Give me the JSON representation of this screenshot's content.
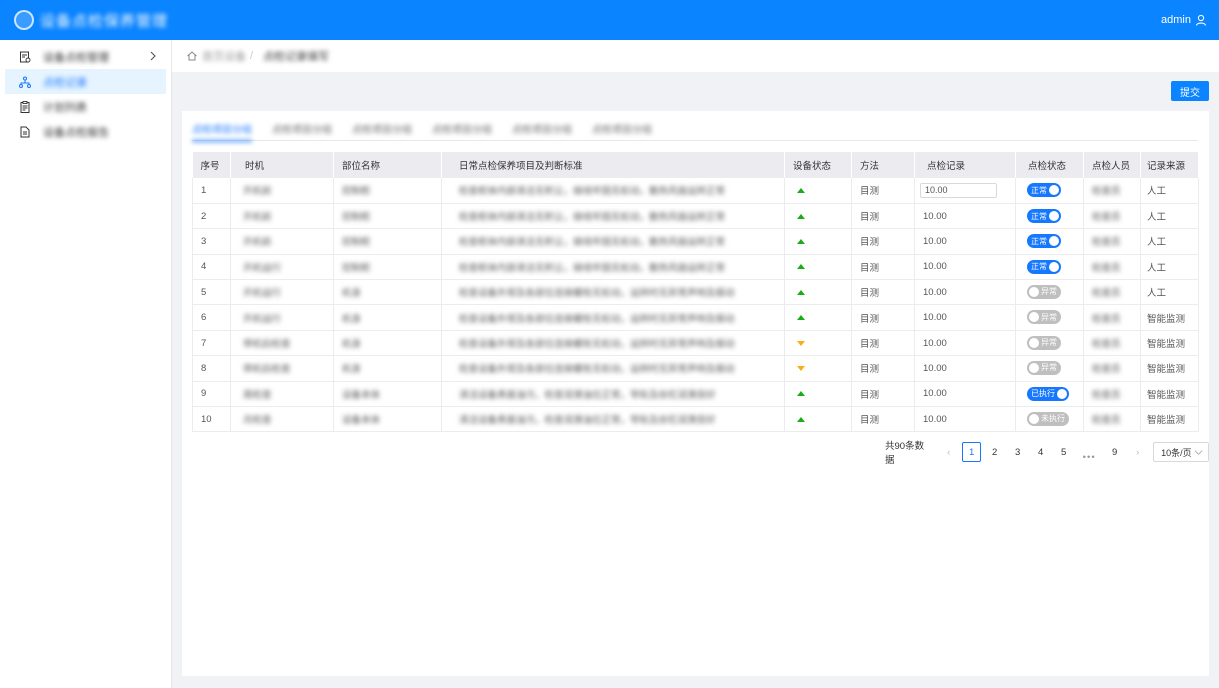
{
  "header": {
    "app_title": "设备点检保养管理",
    "user_name": "admin",
    "user_icon": "user-icon",
    "colors": {
      "primary": "#0a84ff"
    }
  },
  "sidebar": {
    "items": [
      {
        "label": "设备点检管理",
        "icon": "document-check-icon",
        "active": false,
        "has_arrow": true
      },
      {
        "label": "点检记录",
        "icon": "tree-structure-icon",
        "active": true
      },
      {
        "label": "计划列表",
        "icon": "clipboard-icon",
        "active": false
      },
      {
        "label": "设备点检报告",
        "icon": "file-icon",
        "active": false
      }
    ]
  },
  "breadcrumb": {
    "home": "首页设备",
    "current": "点检记录填写"
  },
  "submit_label": "提交",
  "tabs": [
    "点检项目分组",
    "点检项目分组",
    "点检项目分组",
    "点检项目分组",
    "点检项目分组",
    "点检项目分组"
  ],
  "table": {
    "columns": [
      "序号",
      "时机",
      "部位名称",
      "日常点检保养项目及判断标准",
      "设备状态",
      "方法",
      "点检记录",
      "点检状态",
      "点检人员",
      "记录来源"
    ],
    "rows": [
      {
        "no": "1",
        "timing": "开机前",
        "part": "控制柜",
        "standard": "检查柜体内部清洁无积尘，接线牢固无松动，散热风扇运转正常",
        "status": "up",
        "method": "目测",
        "record": "10.00",
        "editable": true,
        "check": "正常",
        "check_on": true,
        "inspector": "检查员",
        "source": "人工"
      },
      {
        "no": "2",
        "timing": "开机前",
        "part": "控制柜",
        "standard": "检查柜体内部清洁无积尘，接线牢固无松动，散热风扇运转正常",
        "status": "up",
        "method": "目测",
        "record": "10.00",
        "editable": false,
        "check": "正常",
        "check_on": true,
        "inspector": "检查员",
        "source": "人工"
      },
      {
        "no": "3",
        "timing": "开机前",
        "part": "控制柜",
        "standard": "检查柜体内部清洁无积尘，接线牢固无松动，散热风扇运转正常",
        "status": "up",
        "method": "目测",
        "record": "10.00",
        "editable": false,
        "check": "正常",
        "check_on": true,
        "inspector": "检查员",
        "source": "人工"
      },
      {
        "no": "4",
        "timing": "开机运行",
        "part": "控制柜",
        "standard": "检查柜体内部清洁无积尘，接线牢固无松动，散热风扇运转正常",
        "status": "up",
        "method": "目测",
        "record": "10.00",
        "editable": false,
        "check": "正常",
        "check_on": true,
        "inspector": "检查员",
        "source": "人工"
      },
      {
        "no": "5",
        "timing": "开机运行",
        "part": "机身",
        "standard": "检查设备外观及各部位连接螺栓无松动，运转时无异常声响及振动",
        "status": "up",
        "method": "目测",
        "record": "10.00",
        "editable": false,
        "check": "异常",
        "check_on": false,
        "inspector": "检查员",
        "source": "人工"
      },
      {
        "no": "6",
        "timing": "开机运行",
        "part": "机身",
        "standard": "检查设备外观及各部位连接螺栓无松动，运转时无异常声响及振动",
        "status": "up",
        "method": "目测",
        "record": "10.00",
        "editable": false,
        "check": "异常",
        "check_on": false,
        "inspector": "检查员",
        "source": "智能监测"
      },
      {
        "no": "7",
        "timing": "停机后检查",
        "part": "机身",
        "standard": "检查设备外观及各部位连接螺栓无松动，运转时无异常声响及振动",
        "status": "down",
        "method": "目测",
        "record": "10.00",
        "editable": false,
        "check": "异常",
        "check_on": false,
        "inspector": "检查员",
        "source": "智能监测"
      },
      {
        "no": "8",
        "timing": "停机后检查",
        "part": "机身",
        "standard": "检查设备外观及各部位连接螺栓无松动，运转时无异常声响及振动",
        "status": "down",
        "method": "目测",
        "record": "10.00",
        "editable": false,
        "check": "异常",
        "check_on": false,
        "inspector": "检查员",
        "source": "智能监测"
      },
      {
        "no": "9",
        "timing": "周检查",
        "part": "设备本体",
        "standard": "清洁设备表面油污，检查润滑油位正常，导轨及丝杠润滑良好",
        "status": "up",
        "method": "目测",
        "record": "10.00",
        "editable": false,
        "check": "已执行",
        "check_on": true,
        "inspector": "检查员",
        "source": "智能监测"
      },
      {
        "no": "10",
        "timing": "月检查",
        "part": "设备本体",
        "standard": "清洁设备表面油污，检查润滑油位正常，导轨及丝杠润滑良好",
        "status": "up",
        "method": "目测",
        "record": "10.00",
        "editable": false,
        "check": "未执行",
        "check_on": false,
        "inspector": "检查员",
        "source": "智能监测"
      }
    ]
  },
  "pagination": {
    "total_text": "共90条数据",
    "pages": [
      "1",
      "2",
      "3",
      "4",
      "5"
    ],
    "ellipsis": "•••",
    "last_page": "9",
    "current_page": "1",
    "page_size": "10条/页"
  }
}
